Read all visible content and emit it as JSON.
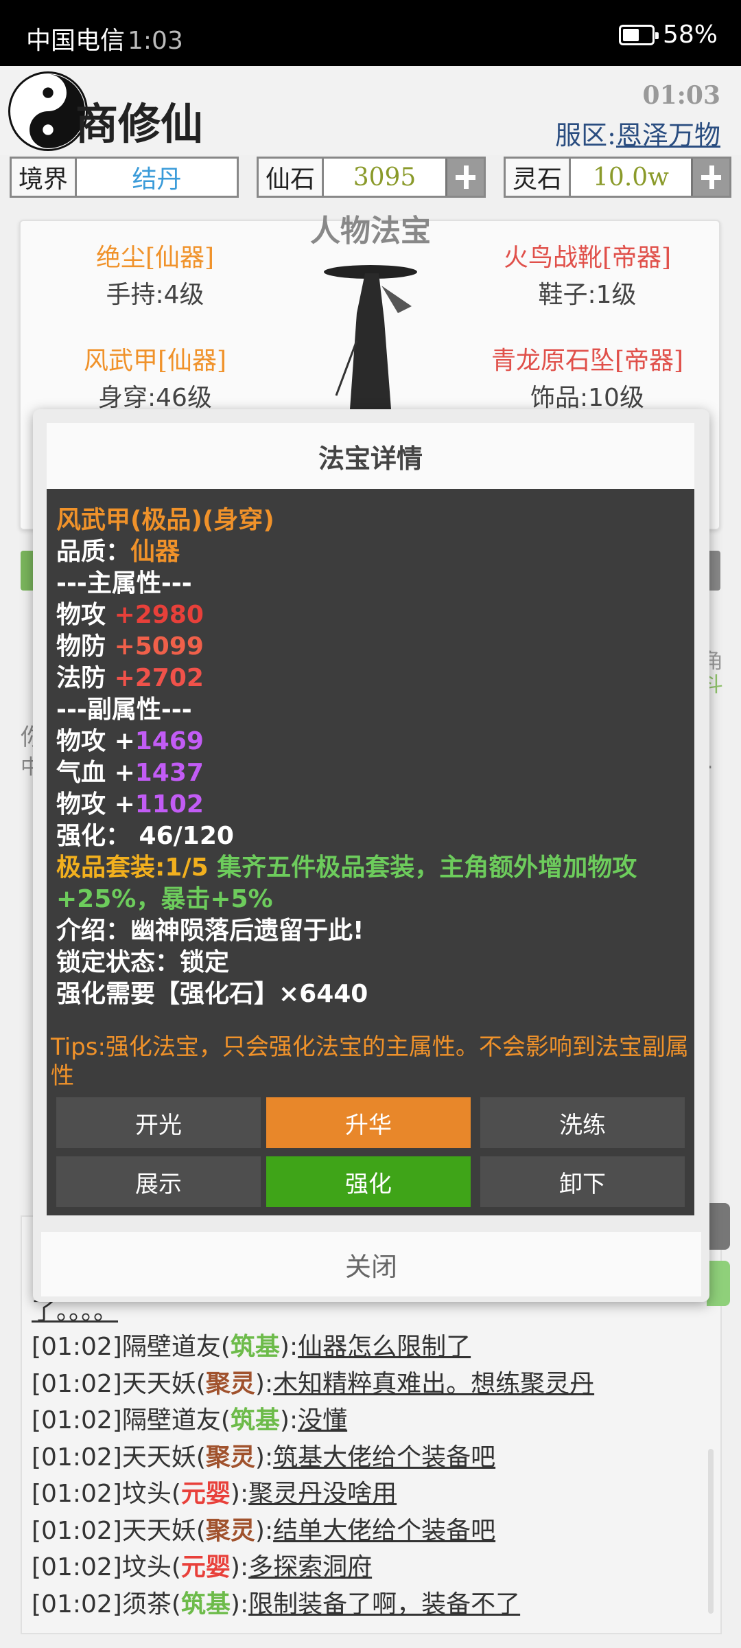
{
  "status_bar": {
    "carrier": "中国电信",
    "time": "1:03",
    "battery_pct": "58%",
    "battery_level": 0.58
  },
  "header": {
    "title": "商修仙",
    "clock": "01:03",
    "server_label": "服区:",
    "server_name": "恩泽万物"
  },
  "resources": [
    {
      "label": "境界",
      "value": "结丹",
      "color": "#3a9bd9"
    },
    {
      "label": "仙石",
      "value": "3095",
      "color": "#8a9a2a"
    },
    {
      "label": "灵石",
      "value": "10.0w",
      "color": "#8a9a2a"
    }
  ],
  "equipment": {
    "title": "人物法宝",
    "items": [
      {
        "name": "绝尘[仙器]",
        "slot": "手持:4级",
        "color": "#f0922a"
      },
      {
        "name": "火鸟战靴[帝器]",
        "slot": "鞋子:1级",
        "color": "#e0504a"
      },
      {
        "name": "风武甲[仙器]",
        "slot": "身穿:46级",
        "color": "#f0922a"
      },
      {
        "name": "青龙原石坠[帝器]",
        "slot": "饰品:10级",
        "color": "#e0504a"
      }
    ]
  },
  "background_fragments": {
    "right1": "角",
    "right2": "斗",
    "left1": "你",
    "left2": "中",
    "dot": "."
  },
  "modal": {
    "title": "法宝详情",
    "item_name": "风武甲(极品)(身穿)",
    "quality_label": "品质：",
    "quality_value": "仙器",
    "main_header": "---主属性---",
    "main_attrs": [
      {
        "name": "物攻",
        "value": "+2980",
        "color": "#e8403a"
      },
      {
        "name": "物防",
        "value": "+5099",
        "color": "#f0604a"
      },
      {
        "name": "法防",
        "value": "+2702",
        "color": "#f0524a"
      }
    ],
    "sub_header": "---副属性---",
    "sub_attrs": [
      {
        "name": "物攻",
        "plus": "+",
        "value": "1469"
      },
      {
        "name": "气血",
        "plus": "+",
        "value": "1437"
      },
      {
        "name": "物攻",
        "plus": "+",
        "value": "1102"
      }
    ],
    "enhance": "强化：  46/120",
    "set_label": "极品套装:1/5",
    "set_desc_1": "集齐五件极品套装，主角额外增加物攻",
    "set_desc_2": "+25%，暴击+5%",
    "intro": "介绍：幽神陨落后遗留于此!",
    "lock": "锁定状态：锁定",
    "cost": "强化需要【强化石】×6440",
    "tips": "Tips:强化法宝，只会强化法宝的主属性。不会影响到法宝副属性",
    "buttons": [
      "开光",
      "升华",
      "洗练",
      "展示",
      "强化",
      "卸下"
    ],
    "close": "关闭"
  },
  "chat": {
    "top_fragment": "了。。。。",
    "messages": [
      {
        "time": "[01:02]",
        "user": "隔壁道友",
        "rank": "筑基",
        "rank_color": "#6dbb4a",
        "msg": "仙器怎么限制了"
      },
      {
        "time": "[01:02]",
        "user": "天天妖",
        "rank": "聚灵",
        "rank_color": "#a0522d",
        "msg": "木知精粹真难出。想练聚灵丹"
      },
      {
        "time": "[01:02]",
        "user": "隔壁道友",
        "rank": "筑基",
        "rank_color": "#6dbb4a",
        "msg": "没懂"
      },
      {
        "time": "[01:02]",
        "user": "天天妖",
        "rank": "聚灵",
        "rank_color": "#a0522d",
        "msg": "筑基大佬给个装备吧"
      },
      {
        "time": "[01:02]",
        "user": "坟头",
        "rank": "元婴",
        "rank_color": "#e8403a",
        "msg": "聚灵丹没啥用"
      },
      {
        "time": "[01:02]",
        "user": "天天妖",
        "rank": "聚灵",
        "rank_color": "#a0522d",
        "msg": "结单大佬给个装备吧"
      },
      {
        "time": "[01:02]",
        "user": "坟头",
        "rank": "元婴",
        "rank_color": "#e8403a",
        "msg": "多探索洞府"
      },
      {
        "time": "[01:02]",
        "user": "须茶",
        "rank": "筑基",
        "rank_color": "#6dbb4a",
        "msg": "限制装备了啊，装备不了"
      }
    ]
  }
}
